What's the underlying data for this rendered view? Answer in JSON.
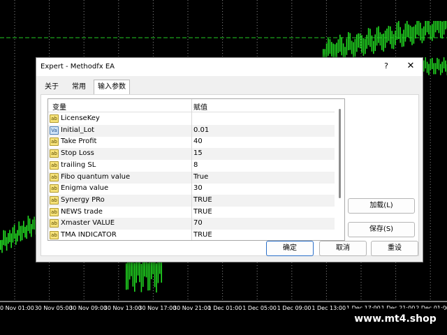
{
  "chart": {
    "background": "#000000",
    "candle_color": "#22dd22",
    "grid_color": "#ffffff",
    "level_line_color": "#22cc22",
    "time_labels": [
      "0 Nov 01:00",
      "30 Nov 05:00",
      "30 Nov 09:00",
      "30 Nov 13:00",
      "30 Nov 17:00",
      "30 Nov 21:00",
      "1 Dec 01:00",
      "1 Dec 05:00",
      "1 Dec 09:00",
      "1 Dec 13:00",
      "1 Dec 17:00",
      "1 Dec 21:00",
      "2 Dec 01:00"
    ]
  },
  "watermark": "www.mt4.shop",
  "dialog": {
    "title": "Expert - Methodfx EA",
    "help_glyph": "?",
    "close_glyph": "✕",
    "tabs": [
      {
        "label": "关于"
      },
      {
        "label": "常用"
      },
      {
        "label": "输入参数"
      }
    ],
    "table": {
      "col_variable": "变量",
      "col_value": "赋值",
      "rows": [
        {
          "icon": "ab",
          "name": "LicenseKey",
          "value": ""
        },
        {
          "icon": "val",
          "name": "Initial_Lot",
          "value": "0.01"
        },
        {
          "icon": "ab",
          "name": "Take Profit",
          "value": "40"
        },
        {
          "icon": "ab",
          "name": "Stop Loss",
          "value": "15"
        },
        {
          "icon": "ab",
          "name": "trailing SL",
          "value": "8"
        },
        {
          "icon": "ab",
          "name": "Fibo quantum value",
          "value": "True"
        },
        {
          "icon": "ab",
          "name": "Enigma value",
          "value": "30"
        },
        {
          "icon": "ab",
          "name": "Synergy PRo",
          "value": "TRUE"
        },
        {
          "icon": "ab",
          "name": "NEWS trade",
          "value": "TRUE"
        },
        {
          "icon": "ab",
          "name": "Xmaster VALUE",
          "value": "70"
        },
        {
          "icon": "ab",
          "name": "TMA INDICATOR",
          "value": "TRUE"
        }
      ]
    },
    "buttons": {
      "load": "加载(L)",
      "save": "保存(S)",
      "ok": "确定",
      "cancel": "取消",
      "reset": "重设"
    }
  }
}
